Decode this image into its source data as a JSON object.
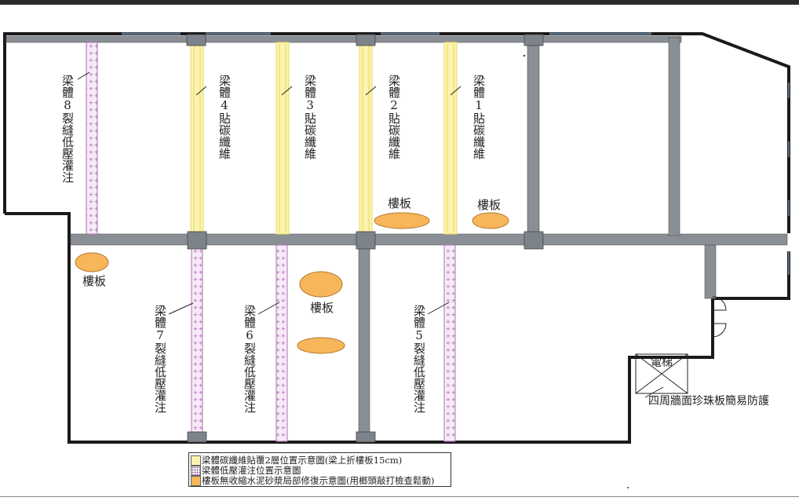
{
  "beams": [
    {
      "id": "beam-8",
      "label": "梁體8裂縫低壓灌注",
      "type": "injection"
    },
    {
      "id": "beam-4",
      "label": "梁體4貼碳纖維",
      "type": "carbon"
    },
    {
      "id": "beam-3",
      "label": "梁體3貼碳纖維",
      "type": "carbon"
    },
    {
      "id": "beam-2",
      "label": "梁體2貼碳纖維",
      "type": "carbon"
    },
    {
      "id": "beam-1",
      "label": "梁體1貼碳纖維",
      "type": "carbon"
    },
    {
      "id": "beam-7",
      "label": "梁體7裂縫低壓灌注",
      "type": "injection"
    },
    {
      "id": "beam-6",
      "label": "梁體6裂縫低壓灌注",
      "type": "injection"
    },
    {
      "id": "beam-5",
      "label": "梁體5裂縫低壓灌注",
      "type": "injection"
    }
  ],
  "slab_labels": [
    "樓板",
    "樓板",
    "樓板",
    "樓板"
  ],
  "elevator_label": "電梯",
  "protection_note": "四周牆面珍珠板簡易防護",
  "legend": [
    {
      "text": "梁體碳纖維貼覆2層位置示意圖(梁上折樓板15cm)",
      "color": "#fbf3b0"
    },
    {
      "text": "梁體低壓灌注位置示意圖",
      "color": "#f3e4f3"
    },
    {
      "text": "樓板無收縮水泥砂漿局部修復示意圖(用榔頭敲打檢查鬆動)",
      "color": "#f5b75a"
    }
  ],
  "colors": {
    "wall": "#1a1a1a",
    "beam": "#8a8f96",
    "carbon_fill": "#fbf3b0",
    "carbon_stroke": "#e8dc60",
    "injection_fill": "#f6eaf6",
    "injection_dot": "#a055a8",
    "slab_fill": "#f7b65a",
    "slab_stroke": "#b3782e"
  }
}
